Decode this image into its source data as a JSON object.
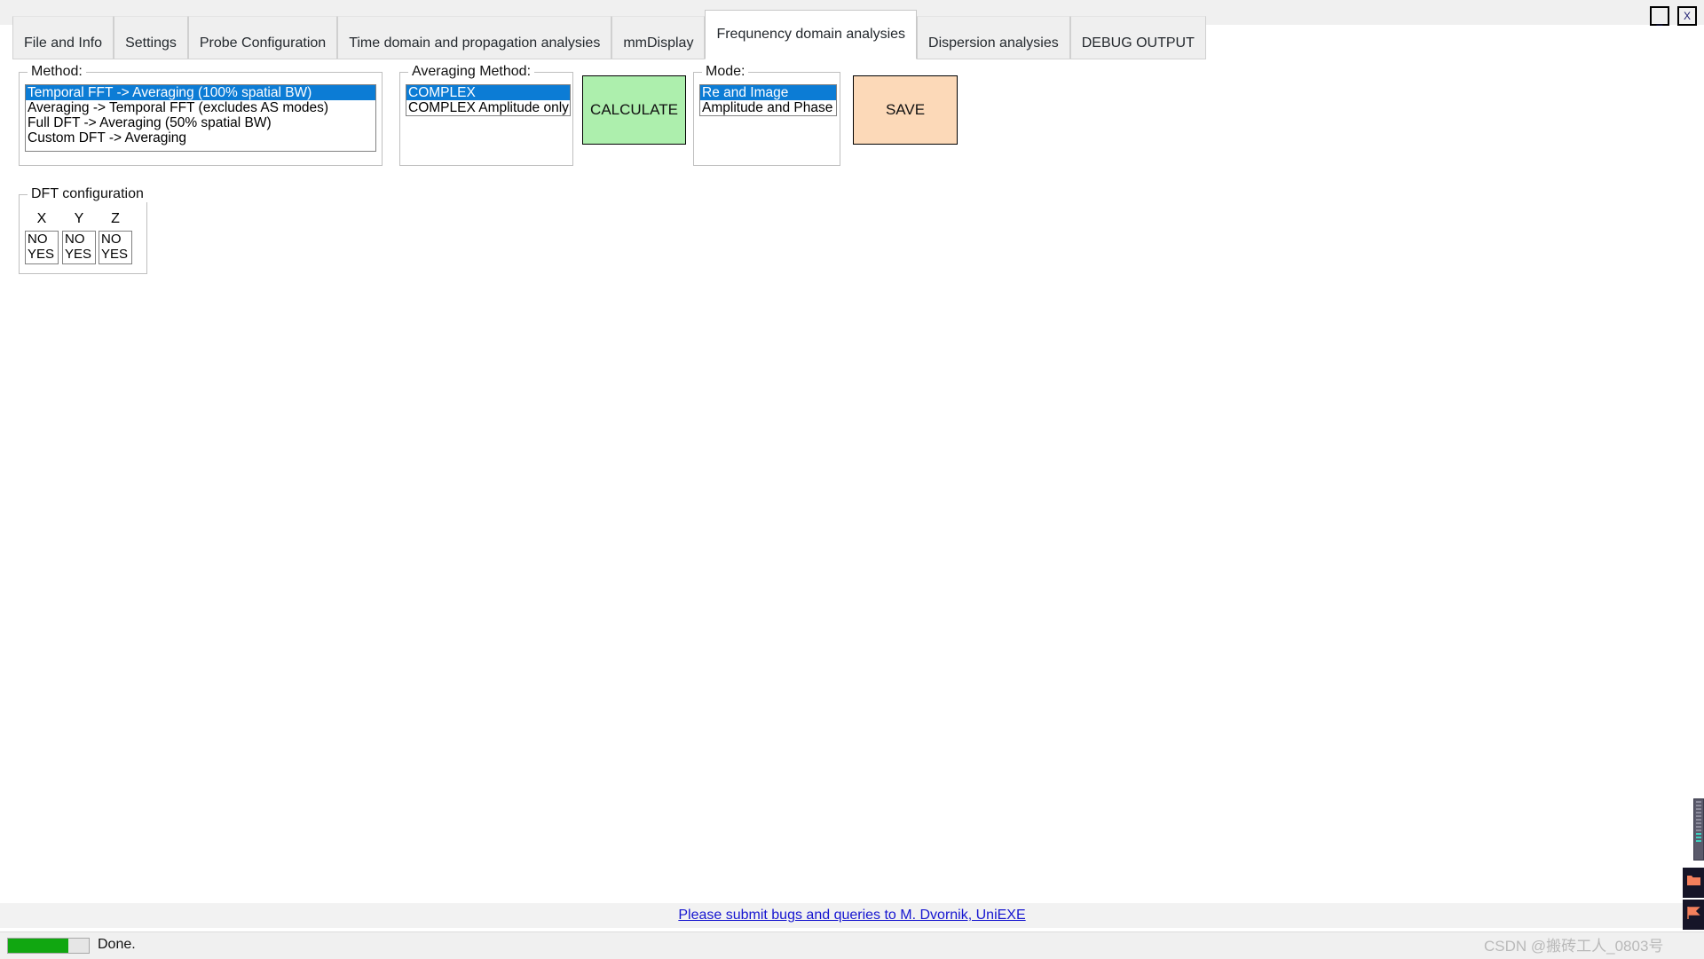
{
  "window": {
    "minimize_label": "_",
    "close_label": "X"
  },
  "tabs": [
    {
      "label": "File and Info",
      "active": false
    },
    {
      "label": "Settings",
      "active": false
    },
    {
      "label": "Probe Configuration",
      "active": false
    },
    {
      "label": "Time domain and propagation analysies",
      "active": false
    },
    {
      "label": "mmDisplay",
      "active": false
    },
    {
      "label": "Frequnency domain analysies",
      "active": true
    },
    {
      "label": "Dispersion analysies",
      "active": false
    },
    {
      "label": "DEBUG OUTPUT",
      "active": false
    }
  ],
  "method_group": {
    "title": "Method:",
    "options": [
      "Temporal FFT -> Averaging (100% spatial BW)",
      "Averaging -> Temporal FFT (excludes AS modes)",
      "Full DFT -> Averaging (50% spatial BW)",
      "Custom DFT -> Averaging"
    ],
    "selected_index": 0
  },
  "averaging_group": {
    "title": "Averaging Method:",
    "options": [
      "COMPLEX",
      "COMPLEX Amplitude only"
    ],
    "selected_index": 0
  },
  "mode_group": {
    "title": "Mode:",
    "options": [
      "Re and Image",
      "Amplitude and Phase"
    ],
    "selected_index": 0
  },
  "buttons": {
    "calculate_label": "CALCULATE",
    "calculate_color": "#adefad",
    "save_label": "SAVE",
    "save_color": "#fcd9b8"
  },
  "dft_group": {
    "title": "DFT configuration",
    "axes": [
      {
        "label": "X",
        "options": [
          "NO",
          "YES"
        ],
        "selected_index": -1
      },
      {
        "label": "Y",
        "options": [
          "NO",
          "YES"
        ],
        "selected_index": -1
      },
      {
        "label": "Z",
        "options": [
          "NO",
          "YES"
        ],
        "selected_index": -1
      }
    ]
  },
  "footer": {
    "bug_link": "Please submit bugs and queries to M. Dvornik, UniEXE"
  },
  "status": {
    "progress_percent": 75,
    "progress_color": "#11a711",
    "message": "Done."
  },
  "right_edge": {
    "scrollbar_name": "vertical-scrollbar-thumb",
    "folder_icon": "folder-icon",
    "flag_icon": "flag-icon"
  },
  "watermark": {
    "text": "CSDN @搬砖工人_0803号"
  }
}
